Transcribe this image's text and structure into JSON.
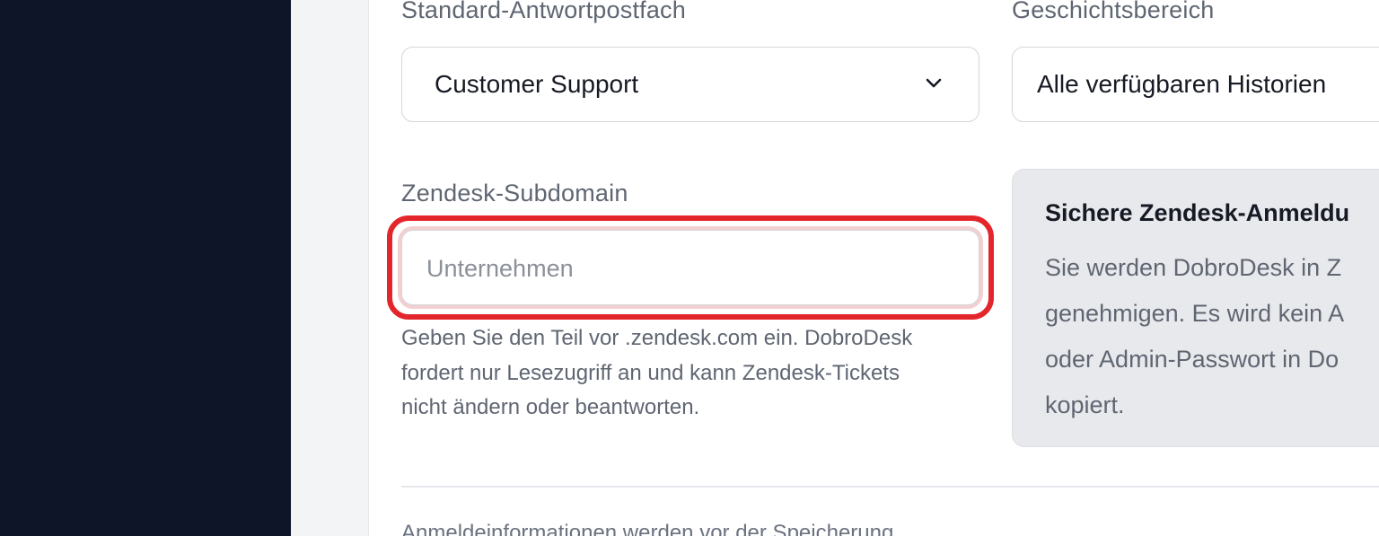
{
  "form": {
    "reply_inbox": {
      "label": "Standard-Antwortpostfach",
      "value": "Customer Support"
    },
    "history_scope": {
      "label": "Geschichtsbereich",
      "value": "Alle verfügbaren Historien"
    },
    "subdomain": {
      "label": "Zendesk-Subdomain",
      "placeholder": "Unternehmen",
      "help_lines": [
        "Geben Sie den Teil vor .zendesk.com ein. DobroDesk",
        "fordert nur Lesezugriff an und kann Zendesk-Tickets",
        "nicht ändern oder beantworten."
      ]
    }
  },
  "info_card": {
    "title": "Sichere Zendesk-Anmeldu",
    "body_lines": [
      "Sie werden DobroDesk in Z",
      "genehmigen. Es wird kein A",
      "oder Admin-Passwort in Do",
      "kopiert."
    ]
  },
  "footer": {
    "note": "Anmeldeinformationen werden vor der Speicherung"
  },
  "icons": {
    "select_chevron": "chevron-down-icon"
  },
  "colors": {
    "sidebar": "#0e1528",
    "highlight": "#e3262b"
  }
}
